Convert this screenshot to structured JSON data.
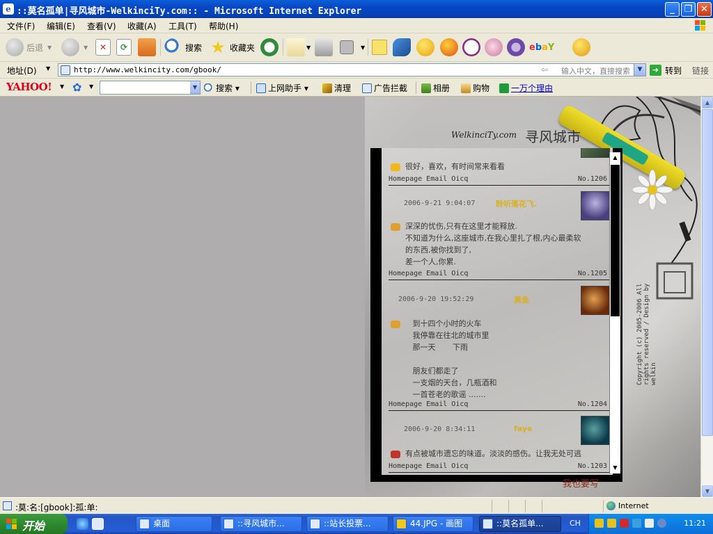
{
  "window": {
    "title": "::莫名孤单|寻风城市-WelkinciTy.com:: - Microsoft Internet Explorer"
  },
  "menu": [
    "文件(F)",
    "编辑(E)",
    "查看(V)",
    "收藏(A)",
    "工具(T)",
    "帮助(H)"
  ],
  "toolbar": {
    "back": "后退",
    "search": "搜索",
    "favorites": "收藏夹"
  },
  "address": {
    "label": "地址(D)",
    "url": "http://www.welkincity.com/gbook/",
    "hint": "输入中文，直接搜索",
    "go": "转到",
    "links": "链接"
  },
  "yahoo": {
    "logo": "YAHOO!",
    "search": "搜索",
    "assistant": "上网助手",
    "clean": "清理",
    "adblock": "广告拦截",
    "album": "相册",
    "shop": "购物",
    "reason": "一万个理由"
  },
  "site": {
    "brand": "WelkinciTy.com",
    "brand_cn": "寻风城市",
    "write": "我也要写",
    "copyright": "Copyright (c) 2005-2006 All rights reserved / Design by welkin"
  },
  "gbook": {
    "footer_links": "Homepage   Email   Oicq",
    "entries": [
      {
        "date": "",
        "name": "",
        "message": "很好，喜欢，有时间常来看看",
        "no": "No.1206"
      },
      {
        "date": "2006-9-21 9:04:07",
        "name": "聆听落花飞.",
        "message": "深深的忧伤,只有在这里才能释放.\n不知道为什么,这座城市,在我心里扎了根,内心最柔软\n的东西,被你找到了,\n差一个人,你累.",
        "no": "No.1205"
      },
      {
        "date": "2006-9-20 19:52:29",
        "name": "黑鱼",
        "message": "   到十四个小时的火车\n   我停靠在往北的城市里\n   那一天       下雨\n\n   朋友们都走了\n   一支烟的天台，几瓶酒和\n   一首苍老的歌谣 .......",
        "no": "No.1204"
      },
      {
        "date": "2006-9-20 8:34:11",
        "name": "faye",
        "message": "有点被城市遗忘的味道。淡淡的感伤。让我无处可逃",
        "no": "No.1203"
      }
    ]
  },
  "status": {
    "text": ":莫:名:[gbook]:孤:单:",
    "zone": "Internet"
  },
  "taskbar": {
    "start": "开始",
    "tasks": [
      "桌面",
      "::寻风城市...",
      "::站长投票...",
      "44.JPG - 画图",
      "::莫名孤单..."
    ],
    "lang": "CH",
    "clock": "11:21"
  },
  "colors": {
    "title_blue": "#0a46c4",
    "chrome": "#ece9d8",
    "page_bg": "#b0adaf",
    "yahoo_red": "#e0001a",
    "name_gold": "#d8b020"
  }
}
